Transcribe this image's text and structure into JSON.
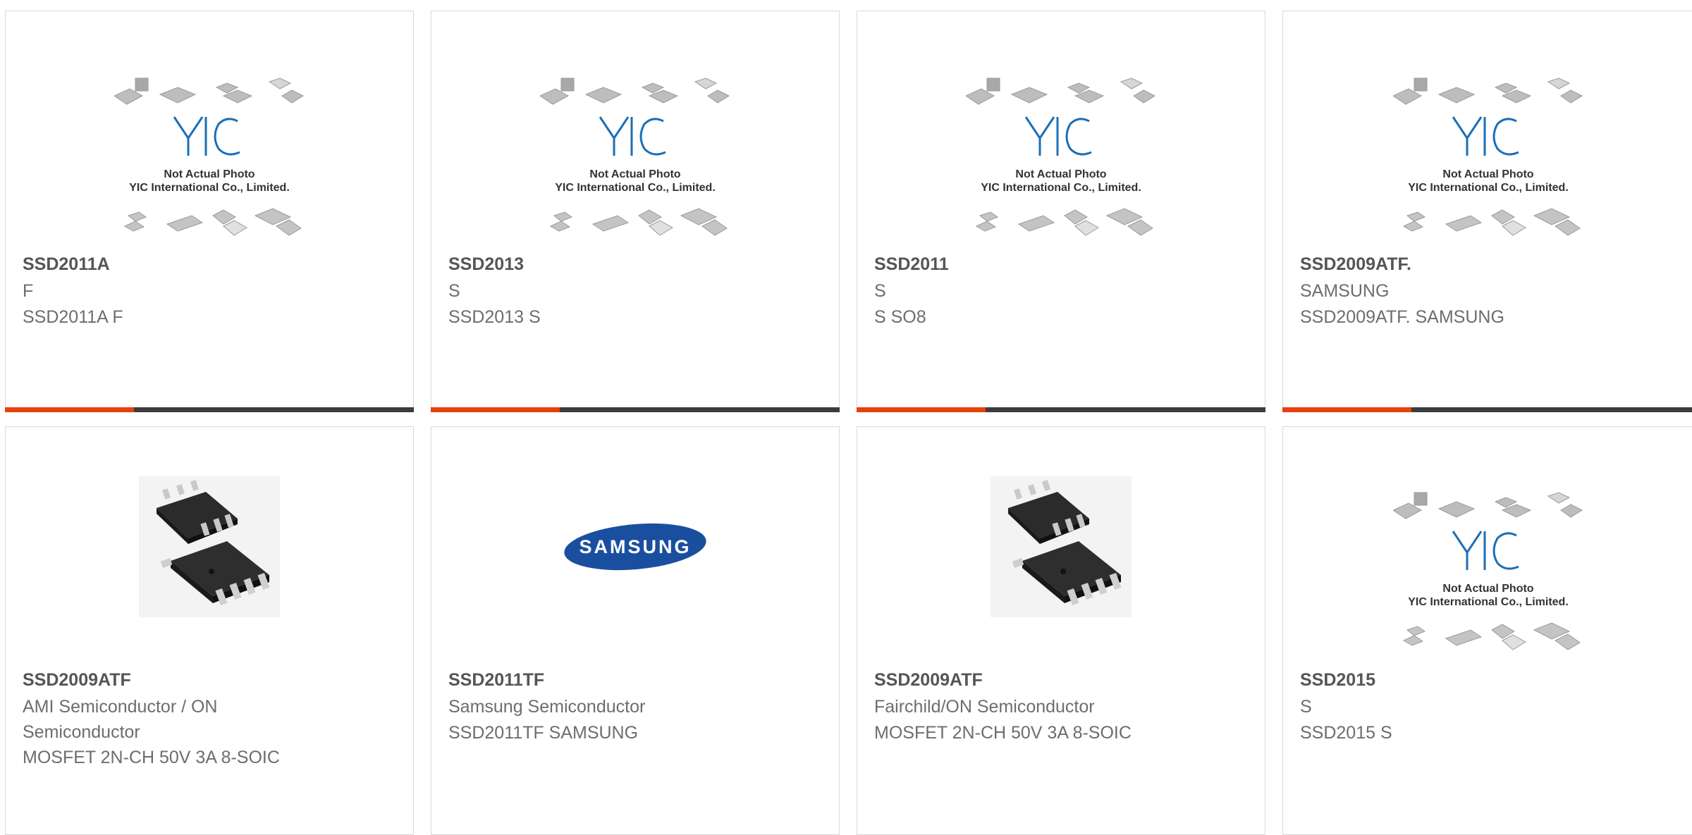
{
  "colors": {
    "accent": "#e8400c",
    "bar": "#3c3c3c",
    "yic_blue": "#1b6fb5",
    "samsung_blue": "#1a4fa0"
  },
  "placeholder": {
    "line1": "Not Actual Photo",
    "line2": "YIC International Co., Limited.",
    "logo": "YIC"
  },
  "samsung_logo_text": "SAMSUNG",
  "products": [
    {
      "part": "SSD2011A",
      "mfr": "F",
      "desc": "SSD2011A F",
      "image": "yic-placeholder"
    },
    {
      "part": "SSD2013",
      "mfr": "S",
      "desc": "SSD2013 S",
      "image": "yic-placeholder"
    },
    {
      "part": "SSD2011",
      "mfr": "S",
      "desc": "S SO8",
      "image": "yic-placeholder"
    },
    {
      "part": "SSD2009ATF.",
      "mfr": "SAMSUNG",
      "desc": "SSD2009ATF. SAMSUNG",
      "image": "yic-placeholder"
    },
    {
      "part": "SSD2009ATF",
      "mfr": "AMI Semiconductor / ON Semiconductor",
      "desc": "MOSFET 2N-CH 50V 3A 8-SOIC",
      "image": "soic8-chip"
    },
    {
      "part": "SSD2011TF",
      "mfr": "Samsung Semiconductor",
      "desc": "SSD2011TF SAMSUNG",
      "image": "samsung-logo"
    },
    {
      "part": "SSD2009ATF",
      "mfr": "Fairchild/ON Semiconductor",
      "desc": "MOSFET 2N-CH 50V 3A 8-SOIC",
      "image": "soic8-chip"
    },
    {
      "part": "SSD2015",
      "mfr": "S",
      "desc": "SSD2015 S",
      "image": "yic-placeholder"
    }
  ]
}
